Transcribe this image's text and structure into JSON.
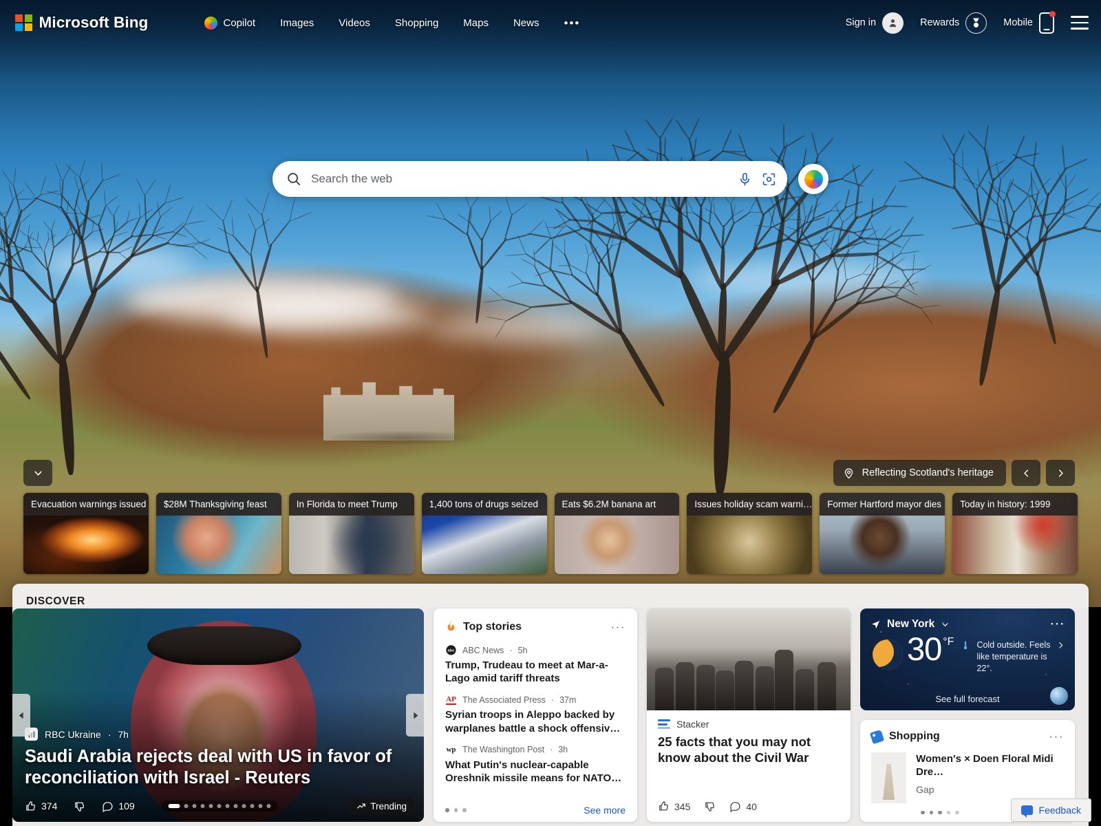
{
  "header": {
    "brand": "Microsoft Bing",
    "nav": [
      {
        "label": "Copilot",
        "icon": "copilot-icon"
      },
      {
        "label": "Images",
        "icon": null
      },
      {
        "label": "Videos",
        "icon": null
      },
      {
        "label": "Shopping",
        "icon": null
      },
      {
        "label": "Maps",
        "icon": null
      },
      {
        "label": "News",
        "icon": null
      },
      {
        "label": "•••",
        "icon": "more-icon"
      }
    ],
    "sign_in": "Sign in",
    "rewards": "Rewards",
    "mobile": "Mobile"
  },
  "search": {
    "placeholder": "Search the web",
    "value": "",
    "mic_icon": "microphone-icon",
    "camera_icon": "visual-search-icon",
    "copilot_icon": "copilot-icon"
  },
  "hero": {
    "attribution": "Reflecting Scotland's heritage",
    "location_icon": "location-pin-icon",
    "scroll_icon": "chevron-down-icon",
    "prev_icon": "chevron-left-icon",
    "next_icon": "chevron-right-icon"
  },
  "news_strip": [
    {
      "title": "Evacuation warnings issued",
      "art": "th-fire"
    },
    {
      "title": "$28M Thanksgiving feast",
      "art": "th-moana"
    },
    {
      "title": "In Florida to meet Trump",
      "art": "th-meet"
    },
    {
      "title": "1,400 tons of drugs seized",
      "art": "th-drugs"
    },
    {
      "title": "Eats $6.2M banana art",
      "art": "th-banana"
    },
    {
      "title": "Issues holiday scam warni…",
      "art": "th-fbi"
    },
    {
      "title": "Former Hartford mayor dies",
      "art": "th-mayor"
    },
    {
      "title": "Today in history: 1999",
      "art": "th-history"
    }
  ],
  "discover": {
    "heading": "DISCOVER",
    "featured": {
      "source": "RBC Ukraine",
      "time": "7h",
      "title": "Saudi Arabia rejects deal with US in favor of reconciliation with Israel - Reuters",
      "likes": "374",
      "comments": "109",
      "trending_label": "Trending",
      "like_icon": "thumbs-up-icon",
      "dislike_icon": "thumbs-down-icon",
      "comment_icon": "comment-icon",
      "trending_icon": "trending-up-icon",
      "prev_icon": "chevron-left-icon",
      "next_icon": "chevron-right-icon",
      "total_slides": 12,
      "active_slide": 1
    },
    "top_stories": {
      "title": "Top stories",
      "icon": "fire-icon",
      "menu_icon": "more-options-icon",
      "see_more": "See more",
      "page_dots": 3,
      "active_dot": 1,
      "items": [
        {
          "source": "ABC News",
          "time": "5h",
          "logo": "abc-news-logo",
          "title": "Trump, Trudeau to meet at Mar-a-Lago amid tariff threats"
        },
        {
          "source": "The Associated Press",
          "time": "37m",
          "logo": "ap-logo",
          "title": "Syrian troops in Aleppo backed by warplanes battle a shock offensive b…"
        },
        {
          "source": "The Washington Post",
          "time": "3h",
          "logo": "wapo-logo",
          "title": "What Putin's nuclear-capable Oreshnik missile means for NATO security"
        }
      ]
    },
    "stacker": {
      "source": "Stacker",
      "logo": "stacker-logo",
      "title": "25 facts that you may not know about the Civil War",
      "likes": "345",
      "comments": "40",
      "like_icon": "thumbs-up-icon",
      "dislike_icon": "thumbs-down-icon",
      "comment_icon": "comment-icon"
    },
    "weather": {
      "location": "New York",
      "location_icon": "navigation-arrow-icon",
      "chevron_icon": "chevron-down-icon",
      "menu_icon": "more-options-icon",
      "temperature": "30",
      "unit": "°F",
      "condition_icon": "crescent-moon-icon",
      "thermometer_icon": "thermometer-icon",
      "description": "Cold outside. Feels like temperature is 22°.",
      "see_forecast": "See full forecast",
      "expand_icon": "chevron-right-icon",
      "globe_icon": "weather-globe-icon"
    },
    "shopping": {
      "title": "Shopping",
      "icon": "price-tag-icon",
      "menu_icon": "more-options-icon",
      "product_title": "Women's × Doen Floral Midi Dre…",
      "brand": "Gap",
      "page_dots": 5,
      "active_dot": 1
    }
  },
  "feedback": {
    "label": "Feedback",
    "icon": "feedback-icon"
  },
  "colors": {
    "accent_blue": "#1a56c4",
    "ms_red": "#f25022",
    "ms_green": "#7fba00",
    "ms_blue": "#00a4ef",
    "ms_yellow": "#ffb900",
    "panel_bg": "#f3f2f1"
  }
}
